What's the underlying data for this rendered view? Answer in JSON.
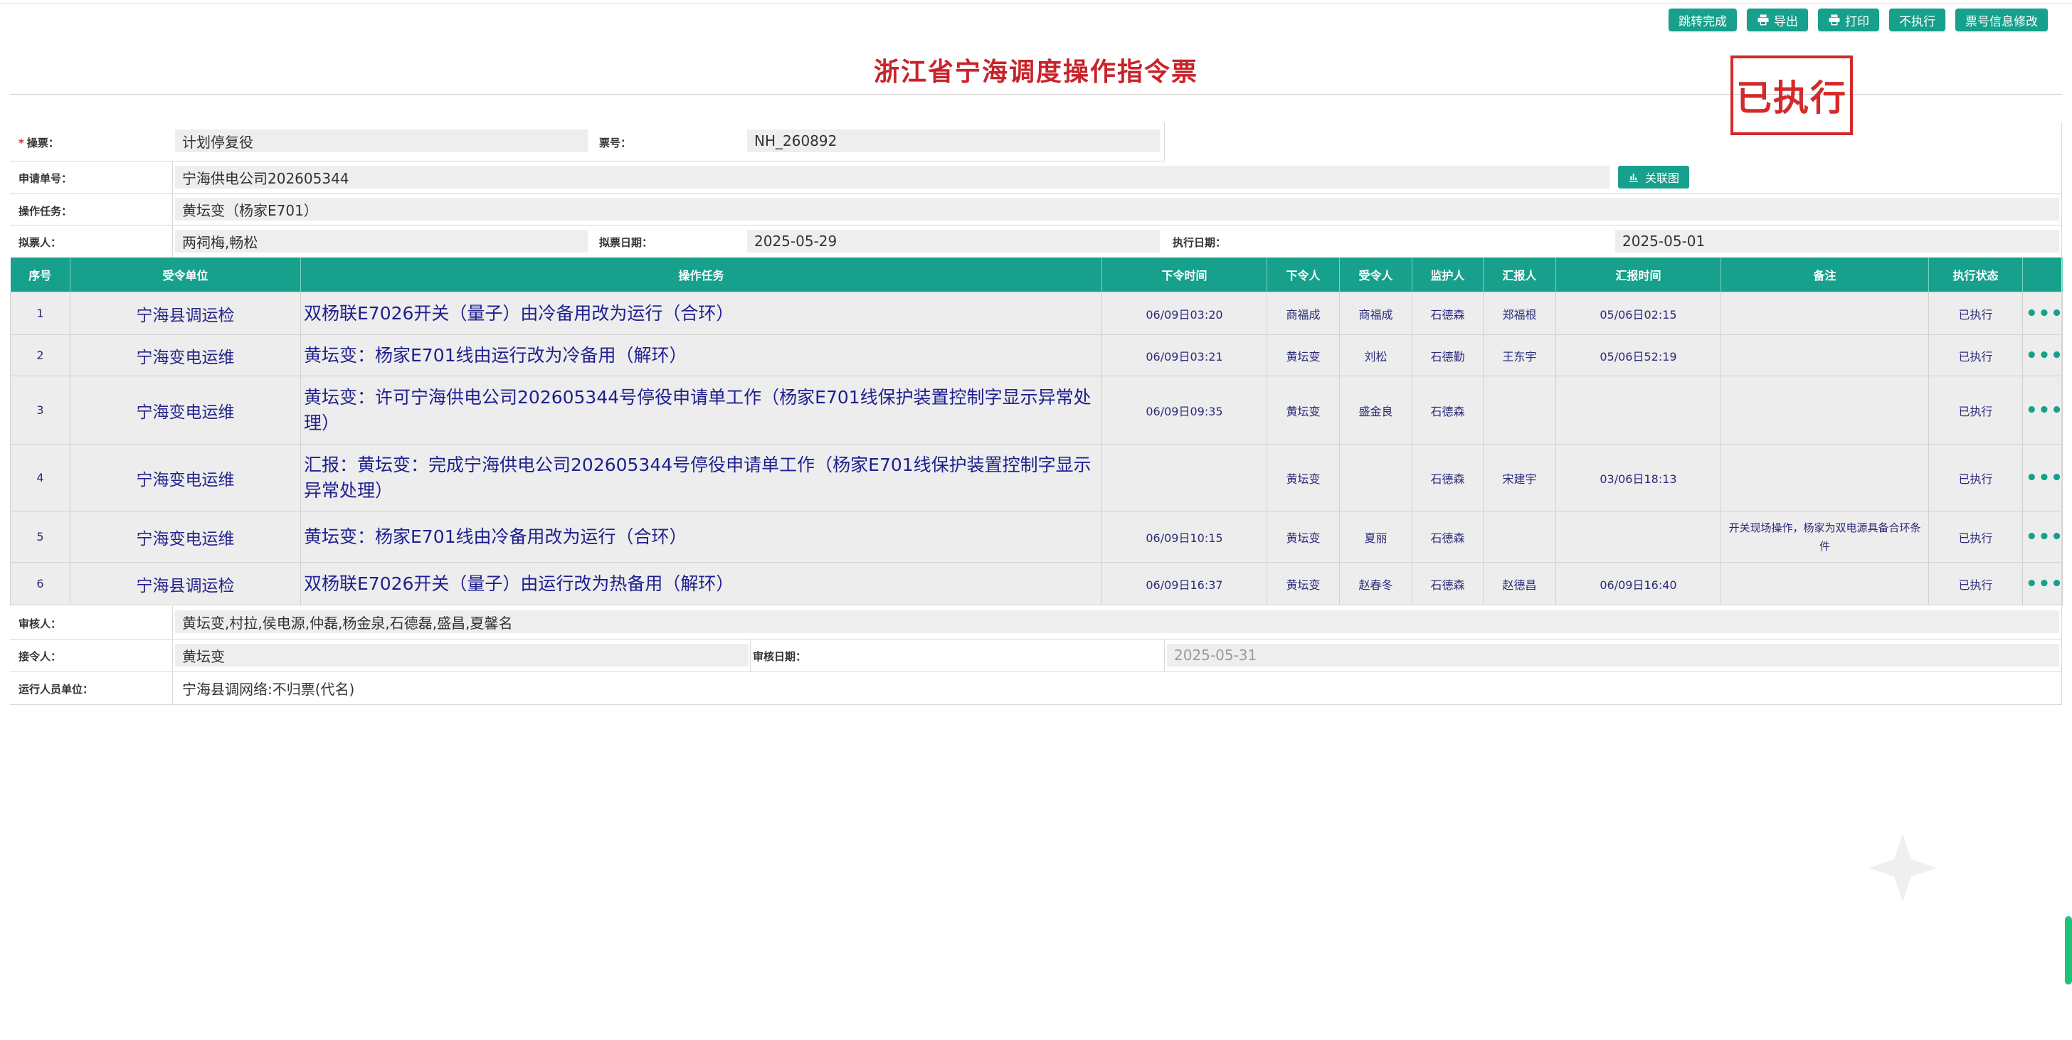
{
  "toolbar": {
    "buttons": [
      "跳转完成",
      "导出",
      "打印",
      "不执行",
      "票号信息修改"
    ]
  },
  "title": "浙江省宁海调度操作指令票",
  "stamp": "已执行",
  "form": {
    "row1": {
      "label1": "操票",
      "value1": "计划停复役",
      "label2": "票号",
      "value2": "NH_260892"
    },
    "row2": {
      "label": "申请单号",
      "value": "宁海供电公司202605344",
      "button": "关联图"
    },
    "row3": {
      "label": "操作任务",
      "value": "黄坛变（杨家E701）"
    },
    "row4": {
      "label1": "拟票人",
      "value1": "两祠梅,畅松",
      "label2": "拟票日期",
      "value2": "2025-05-29",
      "label3": "执行日期",
      "value3": "2025-05-01"
    }
  },
  "table": {
    "headers": [
      "序号",
      "受令单位",
      "操作任务",
      "下令时间",
      "下令人",
      "受令人",
      "监护人",
      "汇报人",
      "汇报时间",
      "备注",
      "执行状态",
      ""
    ],
    "rows": [
      {
        "no": "1",
        "station": "宁海县调运检",
        "task": "双杨联E7026开关（量子）由冷备用改为运行（合环）",
        "time": "06/09日03:20",
        "issuer": "商福成",
        "receiver": "商福成",
        "monitor": "石德森",
        "reporter": "郑福根",
        "rtime": "05/06日02:15",
        "note": "",
        "status": "已执行"
      },
      {
        "no": "2",
        "station": "宁海变电运维",
        "task": "黄坛变：杨家E701线由运行改为冷备用（解环）",
        "time": "06/09日03:21",
        "issuer": "黄坛变",
        "receiver": "刘松",
        "monitor": "石德勤",
        "reporter": "王东宇",
        "rtime": "05/06日52:19",
        "note": "",
        "status": "已执行"
      },
      {
        "no": "3",
        "station": "宁海变电运维",
        "task": "黄坛变：许可宁海供电公司202605344号停役申请单工作（杨家E701线保护装置控制字显示异常处理）",
        "time": "06/09日09:35",
        "issuer": "黄坛变",
        "receiver": "盛金良",
        "monitor": "石德森",
        "reporter": "",
        "rtime": "",
        "note": "",
        "status": "已执行"
      },
      {
        "no": "4",
        "station": "宁海变电运维",
        "task": "汇报：黄坛变：完成宁海供电公司202605344号停役申请单工作（杨家E701线保护装置控制字显示异常处理）",
        "time": "",
        "issuer": "黄坛变",
        "receiver": "",
        "monitor": "石德森",
        "reporter": "宋建宇",
        "rtime": "03/06日18:13",
        "note": "",
        "status": "已执行"
      },
      {
        "no": "5",
        "station": "宁海变电运维",
        "task": "黄坛变：杨家E701线由冷备用改为运行（合环）",
        "time": "06/09日10:15",
        "issuer": "黄坛变",
        "receiver": "夏丽",
        "monitor": "石德森",
        "reporter": "",
        "rtime": "",
        "note": "开关现场操作，杨家为双电源具备合环条件",
        "status": "已执行"
      },
      {
        "no": "6",
        "station": "宁海县调运检",
        "task": "双杨联E7026开关（量子）由运行改为热备用（解环）",
        "time": "06/09日16:37",
        "issuer": "黄坛变",
        "receiver": "赵春冬",
        "monitor": "石德森",
        "reporter": "赵德昌",
        "rtime": "06/09日16:40",
        "note": "",
        "status": "已执行"
      }
    ]
  },
  "footer": {
    "row1": {
      "label": "审核人",
      "value": "黄坛变,村拉,侯电源,仲磊,杨金泉,石德磊,盛昌,夏馨名"
    },
    "row2": {
      "label1": "接令人",
      "value1": "黄坛变",
      "label2": "审核日期",
      "value2": "2025-05-31"
    },
    "row3": {
      "label": "运行人员单位",
      "value": "宁海县调网络:不归票(代名)"
    }
  }
}
